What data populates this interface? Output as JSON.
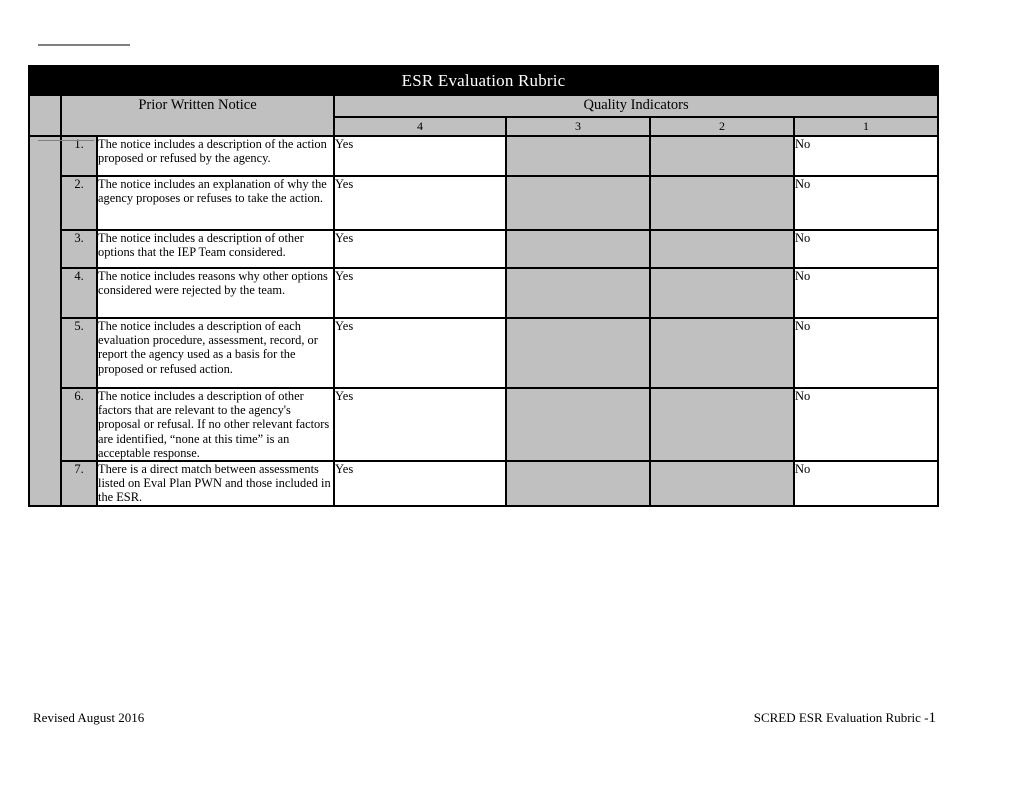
{
  "document": {
    "title": "ESR Evaluation Rubric"
  },
  "table": {
    "section_header": "Prior Written Notice",
    "indicators_header": "Quality Indicators",
    "score_columns": [
      "4",
      "3",
      "2",
      "1"
    ],
    "rows": [
      {
        "number": "1.",
        "criterion": "The notice includes a description of the action proposed or refused by the agency.",
        "score4": "Yes",
        "score3": "",
        "score2": "",
        "score1": "No"
      },
      {
        "number": "2.",
        "criterion": "The notice includes an explanation of why the agency proposes or refuses to take the action.",
        "score4": "Yes",
        "score3": "",
        "score2": "",
        "score1": "No"
      },
      {
        "number": "3.",
        "criterion": "The notice includes a description of other options that the IEP Team considered.",
        "score4": "Yes",
        "score3": "",
        "score2": "",
        "score1": "No"
      },
      {
        "number": "4.",
        "criterion": "The notice includes reasons why other options considered were rejected by the team.",
        "score4": "Yes",
        "score3": "",
        "score2": "",
        "score1": "No"
      },
      {
        "number": "5.",
        "criterion": "The notice includes a description of each evaluation procedure, assessment, record, or report the agency used as a basis for the proposed or refused action.",
        "score4": "Yes",
        "score3": "",
        "score2": "",
        "score1": "No"
      },
      {
        "number": "6.",
        "criterion": "The notice includes a description of other factors that are relevant to the agency's proposal or refusal. If no other relevant factors are identified, “none at this time” is an acceptable response.",
        "score4": "Yes",
        "score3": "",
        "score2": "",
        "score1": "No"
      },
      {
        "number": "7.",
        "criterion": "There is a direct match between assessments listed on Eval Plan PWN and those included in the ESR.",
        "score4": "Yes",
        "score3": "",
        "score2": "",
        "score1": "No"
      }
    ]
  },
  "footer": {
    "left": "Revised August 2016",
    "right": "SCRED ESR Evaluation Rubric -",
    "page_number": "1"
  },
  "colors": {
    "title_bar_bg": "#000000",
    "title_bar_text": "#ffffff",
    "shaded_cell": "#c0c0c0",
    "open_cell": "#ffffff",
    "border": "#000000",
    "rule": "#808080"
  }
}
